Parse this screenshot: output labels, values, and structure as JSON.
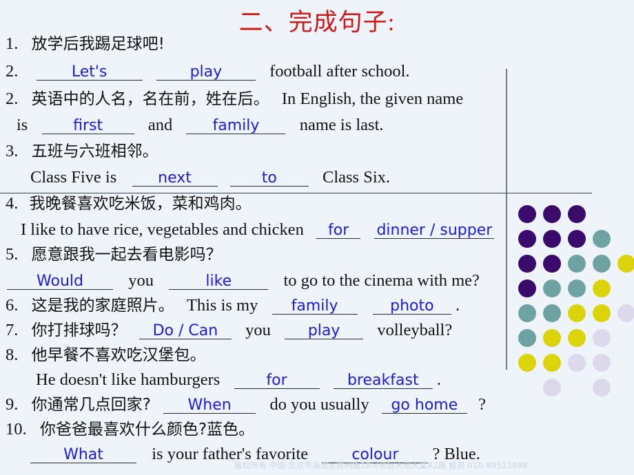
{
  "slide": {
    "title": "二、完成句子:",
    "title_color": "#d11a16",
    "background_color": "#eff4fb",
    "answer_color": "#1a1ae6",
    "watermark": "版权所有 中国·北京市海淀区苏州街18号长远天地大厦A2座 投资  010-89513898"
  },
  "items": [
    {
      "number": "1.",
      "chinese": "放学后我踢足球吧!",
      "english_number": "2.",
      "english_pre": "",
      "blanks": [
        "Let's",
        "play"
      ],
      "english_post": "football after school."
    },
    {
      "number": "2.",
      "chinese": "英语中的人名，名在前，姓在后。",
      "english_lead": "In English, the given name",
      "english_pre": "is",
      "blanks": [
        "first",
        "family"
      ],
      "english_mid": "and",
      "english_post": "name is last."
    },
    {
      "number": "3.",
      "chinese": "五班与六班相邻。",
      "english_pre": "Class Five is",
      "blanks": [
        "next",
        "to"
      ],
      "english_post": "Class Six."
    },
    {
      "number": "4.",
      "chinese": "我晚餐喜欢吃米饭，菜和鸡肉。",
      "english_pre": "I like to have rice, vegetables and chicken",
      "blanks": [
        "for",
        "dinner / supper"
      ],
      "english_post": ""
    },
    {
      "number": "5.",
      "chinese": "愿意跟我一起去看电影吗？",
      "english_pre": "",
      "blanks": [
        "Would",
        "like"
      ],
      "english_mid": "you",
      "english_post": "to go to the cinema with me?"
    },
    {
      "number": "6.",
      "chinese": "这是我的家庭照片。",
      "english_pre": "This is my",
      "blanks": [
        "family",
        "photo"
      ],
      "english_post": "."
    },
    {
      "number": "7.",
      "chinese": "你打排球吗？",
      "english_pre": "",
      "blanks": [
        "Do / Can",
        "play"
      ],
      "english_mid": "you",
      "english_post": "volleyball?"
    },
    {
      "number": "8.",
      "chinese": "他早餐不喜欢吃汉堡包。",
      "english_pre": "He doesn't like hamburgers",
      "blanks": [
        "for",
        "breakfast"
      ],
      "english_post": "."
    },
    {
      "number": "9.",
      "chinese": "你通常几点回家?",
      "english_pre": "",
      "blanks": [
        "When",
        "go home"
      ],
      "english_mid": "do you usually",
      "english_post": "?"
    },
    {
      "number": "10.",
      "chinese": "你爸爸最喜欢什么颜色?蓝色。",
      "english_pre": "",
      "blanks": [
        "What",
        "colour"
      ],
      "english_mid": "is your father's favorite",
      "english_post": "? Blue."
    }
  ],
  "decor": {
    "palette": {
      "purple": "#3b0b6b",
      "teal": "#6fa3a3",
      "yellow": "#dcd40a",
      "lavender": "#dcd9ec"
    },
    "dot_diameter": 26,
    "col_step": 36,
    "row_step": 36,
    "grid": [
      [
        "purple",
        "purple",
        "purple",
        null,
        null
      ],
      [
        "purple",
        "purple",
        "purple",
        "teal",
        null
      ],
      [
        "purple",
        "purple",
        "teal",
        "teal",
        "yellow"
      ],
      [
        "purple",
        "teal",
        "teal",
        "yellow",
        null
      ],
      [
        "teal",
        "teal",
        "yellow",
        "yellow",
        "lavender"
      ],
      [
        "teal",
        "yellow",
        "yellow",
        "lavender",
        null
      ],
      [
        "yellow",
        "yellow",
        "lavender",
        "lavender",
        null
      ],
      [
        null,
        "lavender",
        null,
        "lavender",
        null
      ]
    ]
  }
}
